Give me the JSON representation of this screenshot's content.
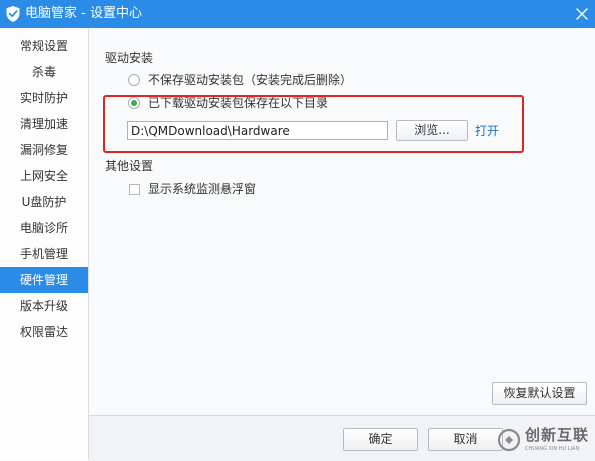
{
  "window": {
    "title": "电脑管家 - 设置中心"
  },
  "sidebar": {
    "items": [
      {
        "label": "常规设置",
        "selected": false
      },
      {
        "label": "杀毒",
        "selected": false
      },
      {
        "label": "实时防护",
        "selected": false
      },
      {
        "label": "清理加速",
        "selected": false
      },
      {
        "label": "漏洞修复",
        "selected": false
      },
      {
        "label": "上网安全",
        "selected": false
      },
      {
        "label": "U盘防护",
        "selected": false
      },
      {
        "label": "电脑诊所",
        "selected": false
      },
      {
        "label": "手机管理",
        "selected": false
      },
      {
        "label": "硬件管理",
        "selected": true
      },
      {
        "label": "版本升级",
        "selected": false
      },
      {
        "label": "权限雷达",
        "selected": false
      }
    ]
  },
  "driver_section": {
    "heading": "驱动安装",
    "options": [
      {
        "label": "不保存驱动安装包（安装完成后删除）",
        "checked": false
      },
      {
        "label": "已下载驱动安装包保存在以下目录",
        "checked": true
      }
    ],
    "path_value": "D:\\QMDownload\\Hardware",
    "browse_label": "浏览...",
    "open_link": "打开"
  },
  "other_section": {
    "heading": "其他设置",
    "checkbox_label": "显示系统监测悬浮窗",
    "checkbox_checked": false
  },
  "restore_defaults_label": "恢复默认设置",
  "footer": {
    "ok_label": "确定",
    "cancel_label": "取消"
  },
  "watermark": {
    "brand": "创新互联",
    "tagline": "CHUANG XIN HU LIAN"
  },
  "icons": {
    "title": "shield-icon",
    "close": "close-icon",
    "watermark": "brand-logo-icon"
  },
  "colors": {
    "accent": "#2b8ce8",
    "selected-bg": "#2b8ce8",
    "radio-checked": "#34b24c",
    "link": "#1b6fd1",
    "highlight": "#e02424"
  }
}
